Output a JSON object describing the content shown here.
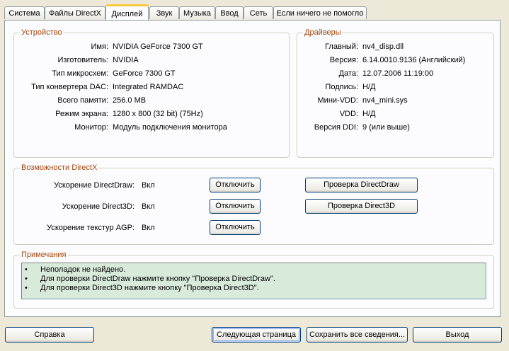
{
  "tabs": [
    "Система",
    "Файлы DirectX",
    "Дисплей",
    "Звук",
    "Музыка",
    "Ввод",
    "Сеть",
    "Если ничего не помогло"
  ],
  "active_tab": "Дисплей",
  "device": {
    "title": "Устройство",
    "rows": [
      {
        "label": "Имя:",
        "value": "NVIDIA GeForce 7300 GT"
      },
      {
        "label": "Изготовитель:",
        "value": "NVIDIA"
      },
      {
        "label": "Тип микросхем:",
        "value": "GeForce 7300 GT"
      },
      {
        "label": "Тип конвертера DAC:",
        "value": "Integrated RAMDAC"
      },
      {
        "label": "Всего памяти:",
        "value": "256.0 MB"
      },
      {
        "label": "Режим экрана:",
        "value": "1280 x 800 (32 bit) (75Hz)"
      },
      {
        "label": "Монитор:",
        "value": "Модуль подключения монитора"
      }
    ]
  },
  "drivers": {
    "title": "Драйверы",
    "rows": [
      {
        "label": "Главный:",
        "value": "nv4_disp.dll"
      },
      {
        "label": "Версия:",
        "value": "6.14.0010.9136 (Английский)"
      },
      {
        "label": "Дата:",
        "value": "12.07.2006 11:19:00"
      },
      {
        "label": "Подпись:",
        "value": "Н/Д"
      },
      {
        "label": "Мини-VDD:",
        "value": "nv4_mini.sys"
      },
      {
        "label": "VDD:",
        "value": "Н/Д"
      },
      {
        "label": "Версия DDI:",
        "value": "9 (или выше)"
      }
    ]
  },
  "directx": {
    "title": "Возможности DirectX",
    "features": [
      {
        "label": "Ускорение DirectDraw:",
        "value": "Вкл",
        "disable_button": "Отключить",
        "test_button": "Проверка DirectDraw"
      },
      {
        "label": "Ускорение Direct3D:",
        "value": "Вкл",
        "disable_button": "Отключить",
        "test_button": "Проверка Direct3D"
      },
      {
        "label": "Ускорение текстур AGP:",
        "value": "Вкл",
        "disable_button": "Отключить"
      }
    ]
  },
  "notes": {
    "title": "Примечания",
    "bullet": "•",
    "items": [
      "Неполадок не найдено.",
      "Для проверки DirectDraw нажмите кнопку \"Проверка DirectDraw\".",
      "Для проверки Direct3D нажмите кнопку \"Проверка Direct3D\"."
    ]
  },
  "footer": {
    "help": "Справка",
    "next": "Следующая страница",
    "save": "Сохранить все сведения...",
    "exit": "Выход"
  }
}
